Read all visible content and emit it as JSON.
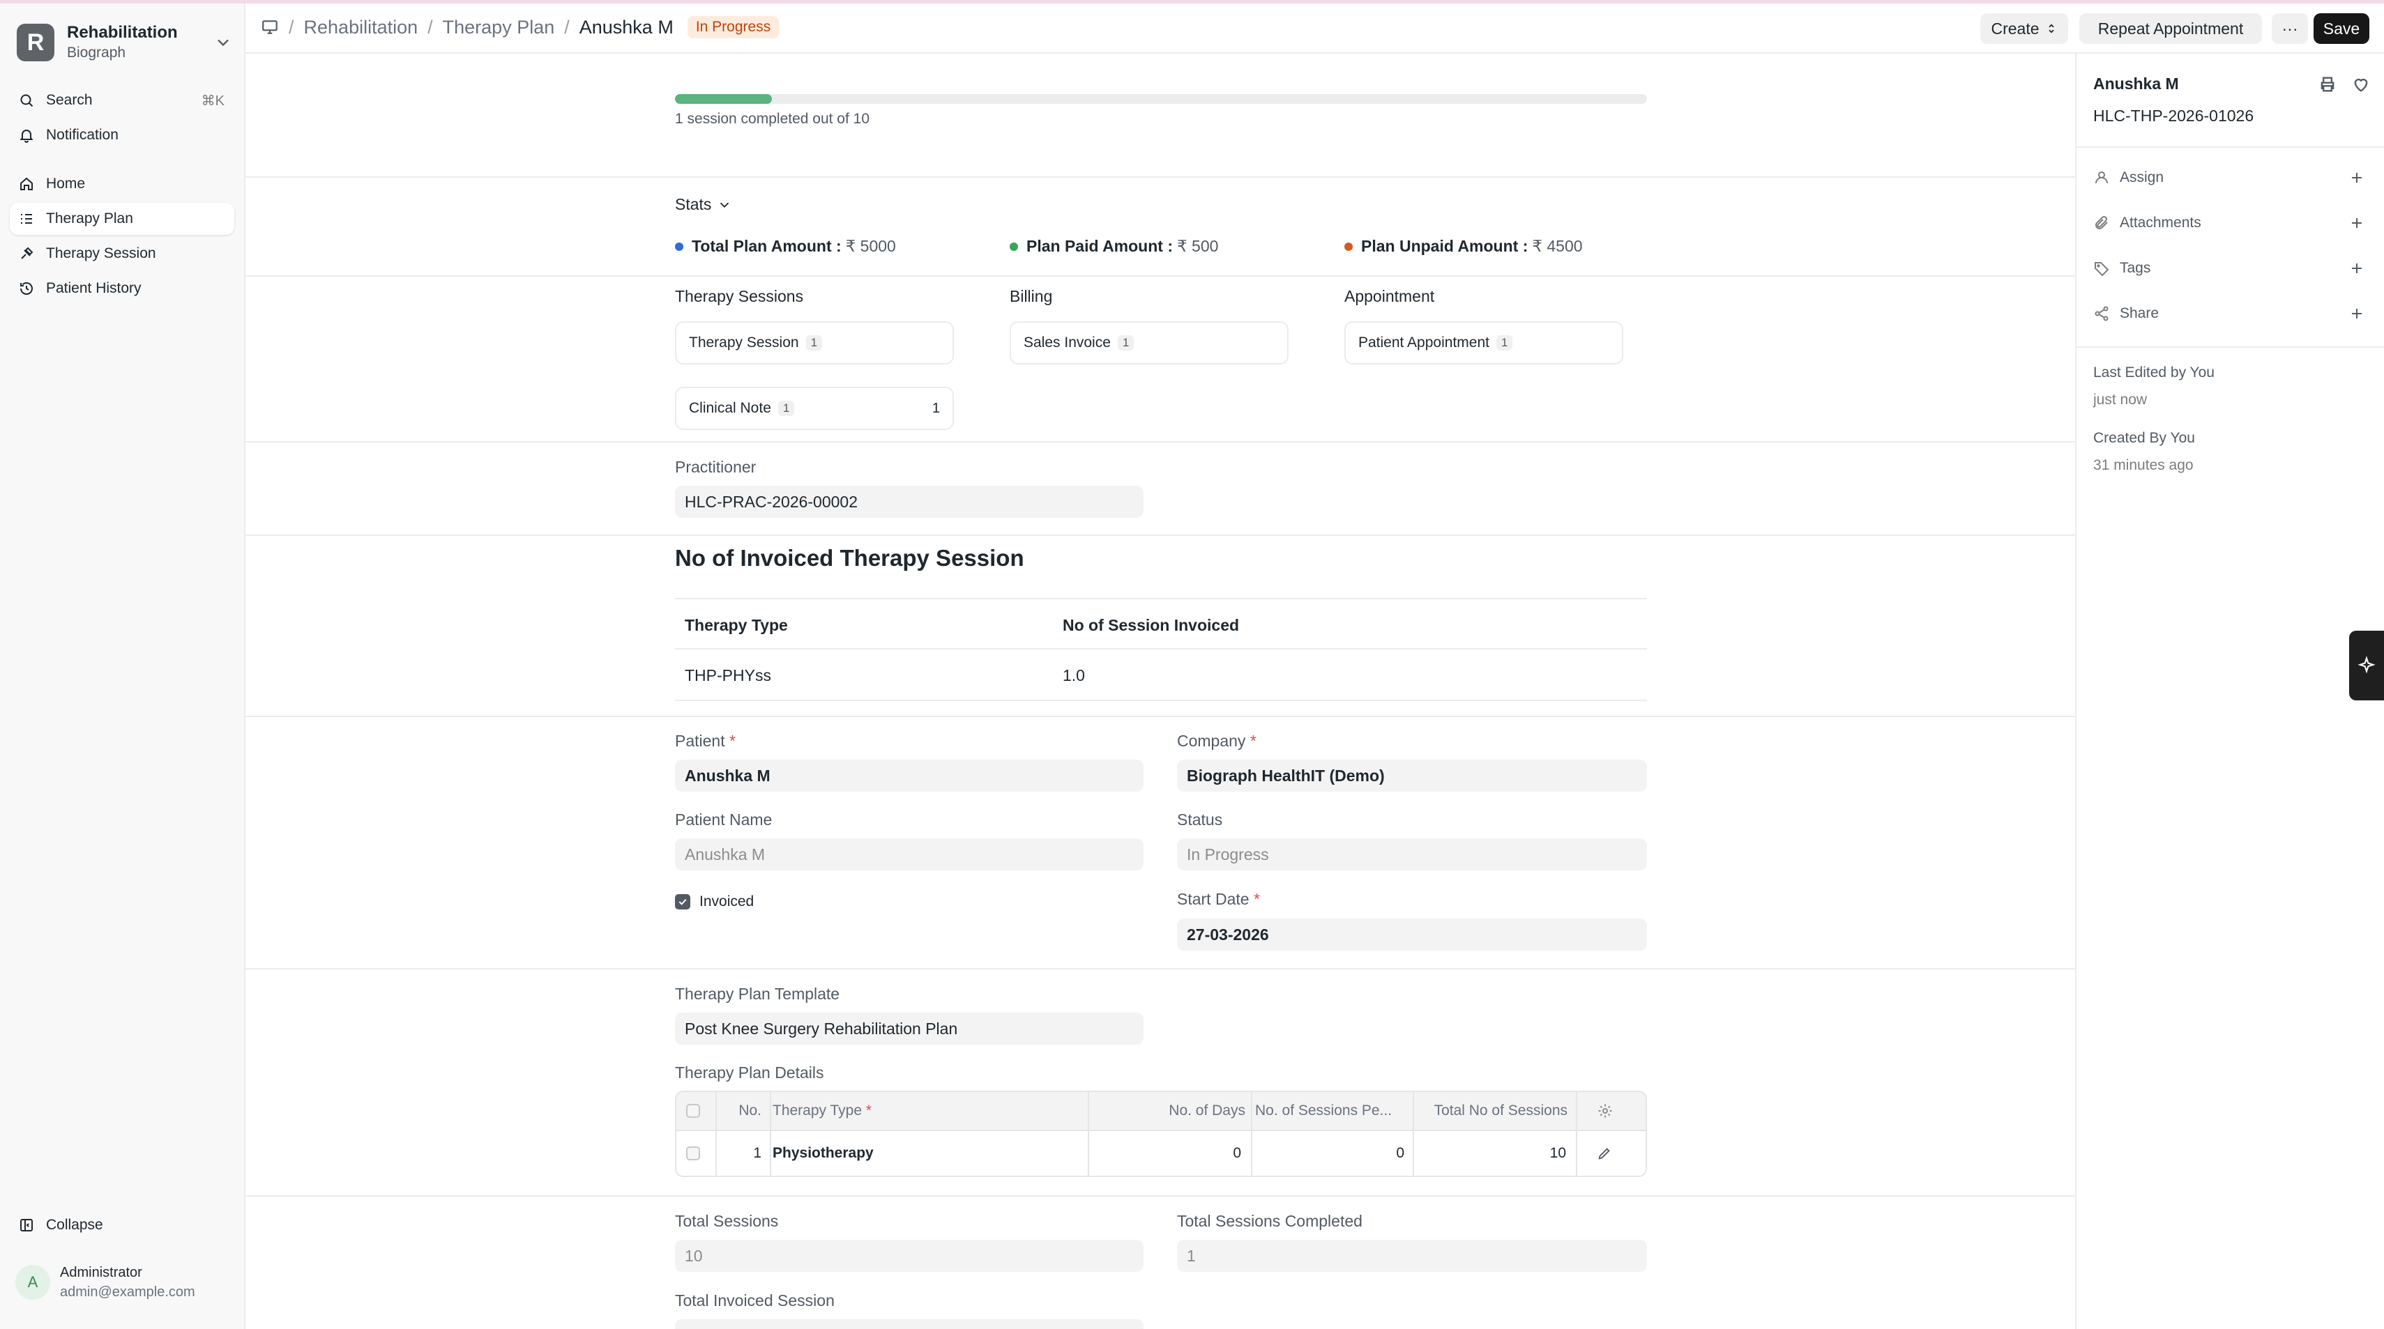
{
  "app": {
    "name": "Rehabilitation",
    "org": "Biograph",
    "logo_letter": "R"
  },
  "sidebar": {
    "search_label": "Search",
    "search_shortcut": "⌘K",
    "notification_label": "Notification",
    "items": [
      {
        "label": "Home",
        "icon": "home-icon"
      },
      {
        "label": "Therapy Plan",
        "icon": "list-icon",
        "active": true
      },
      {
        "label": "Therapy Session",
        "icon": "session-icon"
      },
      {
        "label": "Patient History",
        "icon": "history-icon"
      }
    ],
    "collapse_label": "Collapse"
  },
  "user": {
    "avatar_letter": "A",
    "name": "Administrator",
    "email": "admin@example.com"
  },
  "header": {
    "breadcrumbs": [
      "Rehabilitation",
      "Therapy Plan"
    ],
    "current": "Anushka M",
    "status_badge": "In Progress",
    "buttons": {
      "create": "Create",
      "repeat": "Repeat Appointment",
      "more": "···",
      "save": "Save"
    }
  },
  "progress": {
    "completed": 1,
    "total": 10,
    "fraction": 0.1,
    "text": "1 session completed out of 10"
  },
  "stats": {
    "heading": "Stats",
    "items": [
      {
        "label": "Total Plan Amount :",
        "value": "₹ 5000",
        "color": "#2f6bd9"
      },
      {
        "label": "Plan Paid Amount :",
        "value": "₹ 500",
        "color": "#3aa35c"
      },
      {
        "label": "Plan Unpaid Amount :",
        "value": "₹ 4500",
        "color": "#d65a1f"
      }
    ]
  },
  "connections": {
    "groups": [
      {
        "title": "Therapy Sessions",
        "cards": [
          {
            "label": "Therapy Session",
            "count": "1"
          },
          {
            "label": "Clinical Note",
            "count": "1",
            "extra": "1"
          }
        ]
      },
      {
        "title": "Billing",
        "cards": [
          {
            "label": "Sales Invoice",
            "count": "1"
          }
        ]
      },
      {
        "title": "Appointment",
        "cards": [
          {
            "label": "Patient Appointment",
            "count": "1"
          }
        ]
      }
    ]
  },
  "practitioner": {
    "label": "Practitioner",
    "value": "HLC-PRAC-2026-00002"
  },
  "invoiced_section": {
    "title": "No of Invoiced Therapy Session",
    "headers": [
      "Therapy Type",
      "No of Session Invoiced"
    ],
    "rows": [
      [
        "THP-PHYss",
        "1.0"
      ]
    ]
  },
  "form": {
    "patient": {
      "label": "Patient",
      "value": "Anushka M"
    },
    "company": {
      "label": "Company",
      "value": "Biograph HealthIT (Demo)"
    },
    "patient_name": {
      "label": "Patient Name",
      "value": "Anushka M"
    },
    "status": {
      "label": "Status",
      "value": "In Progress"
    },
    "invoiced": {
      "label": "Invoiced",
      "checked": true
    },
    "start_date": {
      "label": "Start Date",
      "value": "27-03-2026"
    },
    "template": {
      "label": "Therapy Plan Template",
      "value": "Post Knee Surgery Rehabilitation Plan"
    },
    "details_label": "Therapy Plan Details",
    "details_headers": [
      "No.",
      "Therapy Type",
      "No. of Days",
      "No. of Sessions Pe...",
      "Total No of Sessions"
    ],
    "details_rows": [
      {
        "no": "1",
        "therapy_type": "Physiotherapy",
        "days": "0",
        "sessions_per": "0",
        "total": "10"
      }
    ],
    "total_sessions": {
      "label": "Total Sessions",
      "value": "10"
    },
    "total_completed": {
      "label": "Total Sessions Completed",
      "value": "1"
    },
    "total_invoiced": {
      "label": "Total Invoiced Session"
    }
  },
  "right_sidebar": {
    "name": "Anushka M",
    "doc_id": "HLC-THP-2026-01026",
    "actions": [
      "Assign",
      "Attachments",
      "Tags",
      "Share"
    ],
    "last_edited": "Last Edited by You",
    "last_edited_time": "just now",
    "created": "Created By You",
    "created_time": "31 minutes ago"
  },
  "colors": {
    "accent": "#171717",
    "progress": "#5bb37f",
    "required": "#e24c4c",
    "badge_text": "#c2410c",
    "badge_bg": "#fdecde"
  }
}
